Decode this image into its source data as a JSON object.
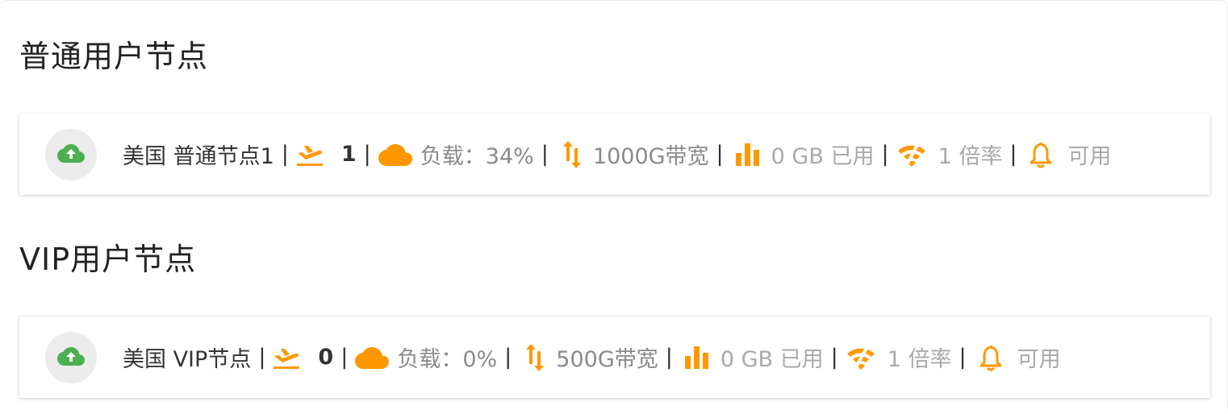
{
  "colors": {
    "accent": "#ff9800",
    "cloud_green": "#4caf50",
    "avatar_bg": "#ececec"
  },
  "sections": [
    {
      "title": "普通用户节点",
      "node": {
        "icon": "cloud-upload-icon",
        "name": "美国 普通节点1",
        "online": "1",
        "load": "负载：34%",
        "bandwidth": "1000G带宽",
        "used": "0 GB 已用",
        "rate": "1 倍率",
        "status": "可用"
      }
    },
    {
      "title": "VIP用户节点",
      "node": {
        "icon": "cloud-upload-icon",
        "name": "美国 VIP节点",
        "online": "0",
        "load": "负载：0%",
        "bandwidth": "500G带宽",
        "used": "0 GB 已用",
        "rate": "1 倍率",
        "status": "可用"
      }
    }
  ],
  "separator": "|"
}
